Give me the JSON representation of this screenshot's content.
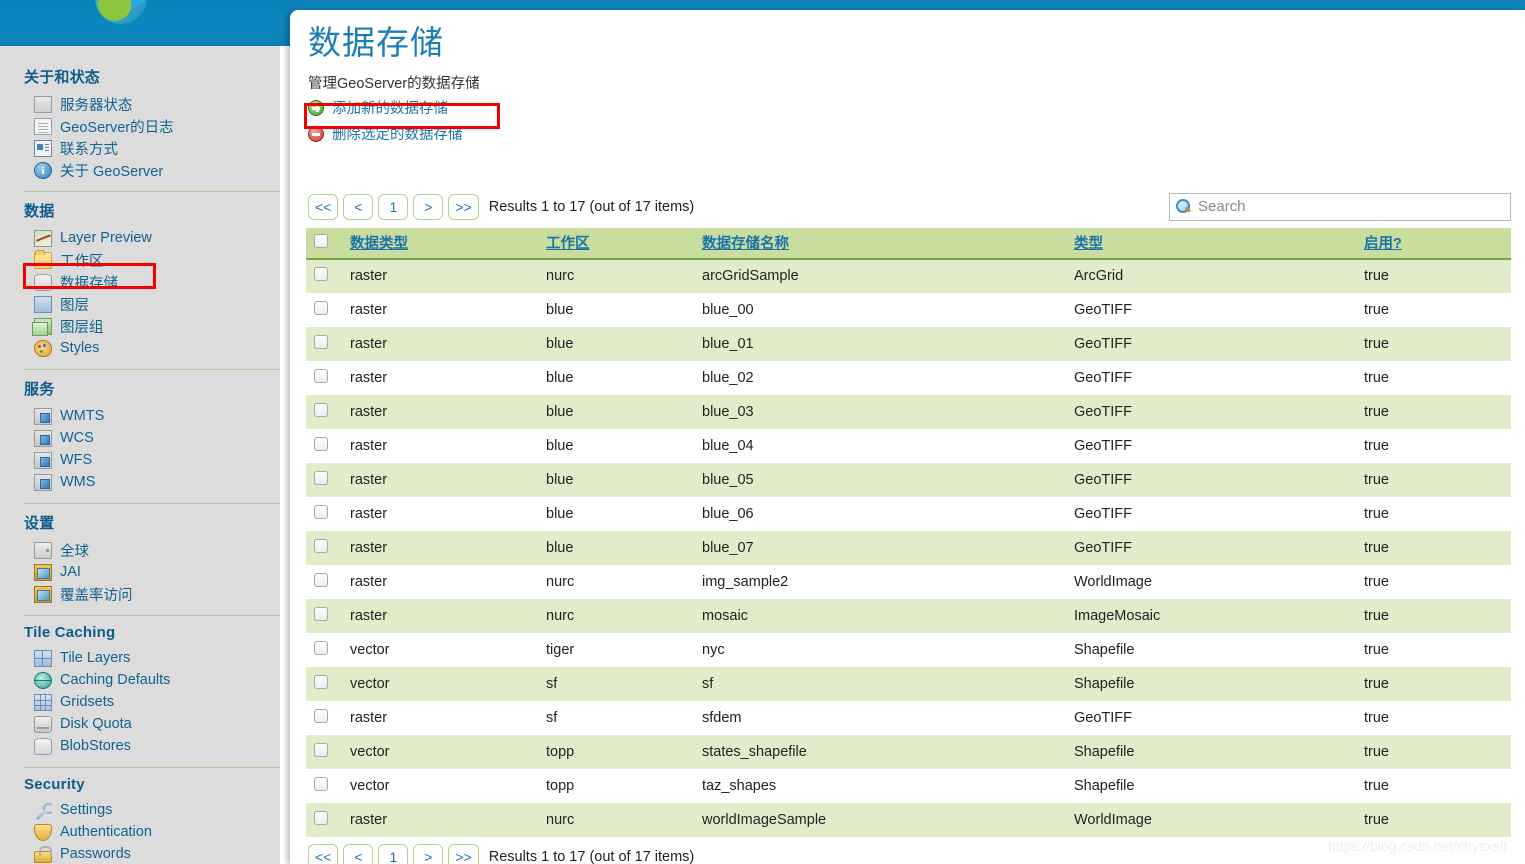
{
  "header": {
    "logo_icon": "geoserver-globe-logo"
  },
  "sidebar": {
    "groups": [
      {
        "title": "关于和状态",
        "items": [
          {
            "label": "服务器状态",
            "icon": "server-status-icon"
          },
          {
            "label": "GeoServer的日志",
            "icon": "log-document-icon"
          },
          {
            "label": "联系方式",
            "icon": "contact-card-icon"
          },
          {
            "label": "关于 GeoServer",
            "icon": "info-circle-icon"
          }
        ]
      },
      {
        "title": "数据",
        "items": [
          {
            "label": "Layer Preview",
            "icon": "map-preview-icon"
          },
          {
            "label": "工作区",
            "icon": "folder-icon"
          },
          {
            "label": "数据存储",
            "icon": "database-icon"
          },
          {
            "label": "图层",
            "icon": "layer-icon"
          },
          {
            "label": "图层组",
            "icon": "layer-group-icon"
          },
          {
            "label": "Styles",
            "icon": "palette-icon"
          }
        ]
      },
      {
        "title": "服务",
        "items": [
          {
            "label": "WMTS",
            "icon": "service-icon"
          },
          {
            "label": "WCS",
            "icon": "service-icon"
          },
          {
            "label": "WFS",
            "icon": "service-icon"
          },
          {
            "label": "WMS",
            "icon": "service-icon"
          }
        ]
      },
      {
        "title": "设置",
        "items": [
          {
            "label": "全球",
            "icon": "global-settings-icon"
          },
          {
            "label": "JAI",
            "icon": "jai-image-icon"
          },
          {
            "label": "覆盖率访问",
            "icon": "coverage-access-icon"
          }
        ]
      },
      {
        "title": "Tile Caching",
        "items": [
          {
            "label": "Tile Layers",
            "icon": "tile-layers-icon"
          },
          {
            "label": "Caching Defaults",
            "icon": "cache-globe-icon"
          },
          {
            "label": "Gridsets",
            "icon": "gridset-icon"
          },
          {
            "label": "Disk Quota",
            "icon": "disk-quota-icon"
          },
          {
            "label": "BlobStores",
            "icon": "blobstore-icon"
          }
        ]
      },
      {
        "title": "Security",
        "items": [
          {
            "label": "Settings",
            "icon": "wrench-icon"
          },
          {
            "label": "Authentication",
            "icon": "shield-icon"
          },
          {
            "label": "Passwords",
            "icon": "lock-icon"
          }
        ]
      }
    ]
  },
  "main": {
    "title": "数据存储",
    "subtitle": "管理GeoServer的数据存储",
    "actions": [
      {
        "label": "添加新的数据存储",
        "icon": "add-circle-icon"
      },
      {
        "label": "删除选定的数据存储",
        "icon": "remove-circle-icon"
      }
    ]
  },
  "pagination": {
    "first": "<<",
    "prev": "<",
    "page": "1",
    "next": ">",
    "last": ">>",
    "results_text": "Results 1 to 17 (out of 17 items)"
  },
  "search": {
    "placeholder": "Search",
    "value": "",
    "icon": "search-icon"
  },
  "table": {
    "columns": [
      {
        "label": "数据类型",
        "sortable": true
      },
      {
        "label": "工作区",
        "sortable": true
      },
      {
        "label": "数据存储名称",
        "sortable": true
      },
      {
        "label": "类型",
        "sortable": true
      },
      {
        "label": "启用?",
        "sortable": true
      }
    ],
    "rows": [
      {
        "data_type": "raster",
        "workspace": "nurc",
        "name": "arcGridSample",
        "kind": "ArcGrid",
        "enabled": "true"
      },
      {
        "data_type": "raster",
        "workspace": "blue",
        "name": "blue_00",
        "kind": "GeoTIFF",
        "enabled": "true"
      },
      {
        "data_type": "raster",
        "workspace": "blue",
        "name": "blue_01",
        "kind": "GeoTIFF",
        "enabled": "true"
      },
      {
        "data_type": "raster",
        "workspace": "blue",
        "name": "blue_02",
        "kind": "GeoTIFF",
        "enabled": "true"
      },
      {
        "data_type": "raster",
        "workspace": "blue",
        "name": "blue_03",
        "kind": "GeoTIFF",
        "enabled": "true"
      },
      {
        "data_type": "raster",
        "workspace": "blue",
        "name": "blue_04",
        "kind": "GeoTIFF",
        "enabled": "true"
      },
      {
        "data_type": "raster",
        "workspace": "blue",
        "name": "blue_05",
        "kind": "GeoTIFF",
        "enabled": "true"
      },
      {
        "data_type": "raster",
        "workspace": "blue",
        "name": "blue_06",
        "kind": "GeoTIFF",
        "enabled": "true"
      },
      {
        "data_type": "raster",
        "workspace": "blue",
        "name": "blue_07",
        "kind": "GeoTIFF",
        "enabled": "true"
      },
      {
        "data_type": "raster",
        "workspace": "nurc",
        "name": "img_sample2",
        "kind": "WorldImage",
        "enabled": "true"
      },
      {
        "data_type": "raster",
        "workspace": "nurc",
        "name": "mosaic",
        "kind": "ImageMosaic",
        "enabled": "true"
      },
      {
        "data_type": "vector",
        "workspace": "tiger",
        "name": "nyc",
        "kind": "Shapefile",
        "enabled": "true"
      },
      {
        "data_type": "vector",
        "workspace": "sf",
        "name": "sf",
        "kind": "Shapefile",
        "enabled": "true"
      },
      {
        "data_type": "raster",
        "workspace": "sf",
        "name": "sfdem",
        "kind": "GeoTIFF",
        "enabled": "true"
      },
      {
        "data_type": "vector",
        "workspace": "topp",
        "name": "states_shapefile",
        "kind": "Shapefile",
        "enabled": "true"
      },
      {
        "data_type": "vector",
        "workspace": "topp",
        "name": "taz_shapes",
        "kind": "Shapefile",
        "enabled": "true"
      },
      {
        "data_type": "raster",
        "workspace": "nurc",
        "name": "worldImageSample",
        "kind": "WorldImage",
        "enabled": "true"
      }
    ]
  },
  "watermark": {
    "text": "https://blog.csdn.net/chysxslt"
  },
  "colors": {
    "header_blue": "#0d87bf",
    "link_blue": "#1b74a8",
    "title_blue": "#1a7fb5",
    "row_green": "#e1edca",
    "header_green": "#c9dd9f",
    "highlight_red": "#f00000",
    "sidebar_gray": "#dcdcdc"
  }
}
